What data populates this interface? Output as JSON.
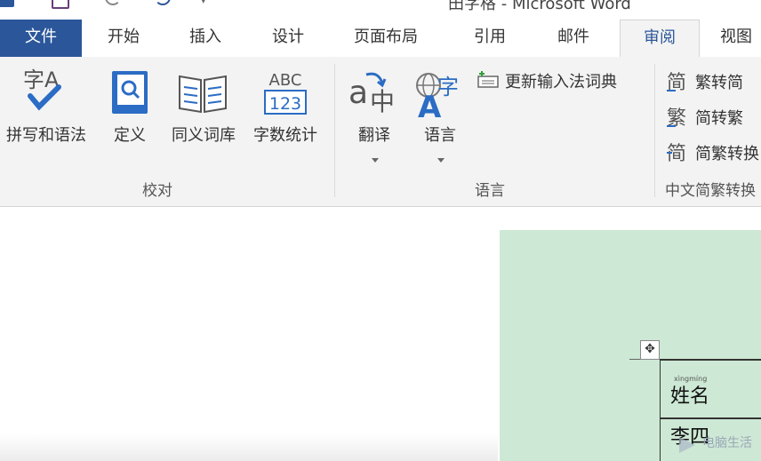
{
  "window": {
    "title": "田字格 - Microsoft Word"
  },
  "quick_access": {
    "icons": [
      "word-app-icon",
      "save-icon",
      "undo-icon",
      "redo-icon",
      "customize-icon"
    ]
  },
  "tabs": [
    {
      "label": "文件"
    },
    {
      "label": "开始"
    },
    {
      "label": "插入"
    },
    {
      "label": "设计"
    },
    {
      "label": "页面布局"
    },
    {
      "label": "引用"
    },
    {
      "label": "邮件"
    },
    {
      "label": "审阅"
    },
    {
      "label": "视图"
    }
  ],
  "active_tab": "审阅",
  "ribbon": {
    "proofing": {
      "group_label": "校对",
      "buttons": [
        {
          "label": "拼写和语法",
          "icon": "spell-check-icon",
          "icon_text": "字A"
        },
        {
          "label": "定义",
          "icon": "define-icon"
        },
        {
          "label": "同义词库",
          "icon": "thesaurus-icon"
        },
        {
          "label": "字数统计",
          "icon": "word-count-icon",
          "icon_text_top": "ABC",
          "icon_text_bottom": "123"
        }
      ]
    },
    "language": {
      "group_label": "语言",
      "buttons": [
        {
          "label": "翻译",
          "icon": "translate-icon",
          "icon_text": "中"
        },
        {
          "label": "语言",
          "icon": "language-icon",
          "icon_text": "字"
        }
      ],
      "small_buttons": [
        {
          "label": "更新输入法词典",
          "icon": "ime-dictionary-icon"
        }
      ]
    },
    "chinese_conversion": {
      "group_label": "中文简繁转换",
      "buttons": [
        {
          "label": "繁转简",
          "icon": "trad-to-simp-icon",
          "icon_text": "简"
        },
        {
          "label": "简转繁",
          "icon": "simp-to-trad-icon",
          "icon_text": "繁"
        },
        {
          "label": "简繁转换",
          "icon": "simp-trad-convert-icon",
          "icon_text": "简"
        }
      ]
    }
  },
  "document": {
    "pinyin": "xìngmíng",
    "cells": [
      "姓名",
      "李四"
    ]
  },
  "watermark": {
    "text": "电脑生活"
  },
  "colors": {
    "accent": "#2b579a",
    "page_green": "#cde8d4",
    "ribbon_bg": "#f3f3f3"
  }
}
